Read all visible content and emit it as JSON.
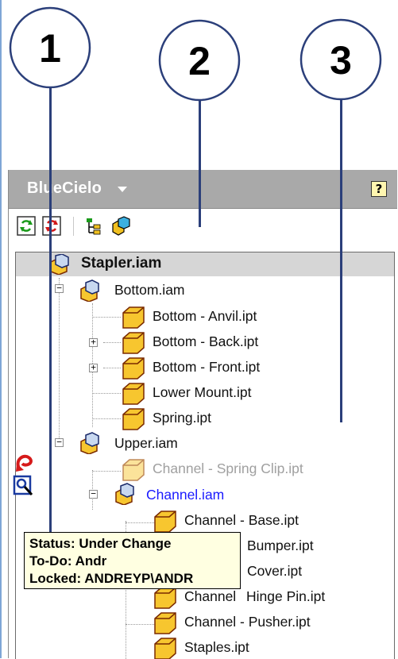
{
  "callouts": [
    "1",
    "2",
    "3"
  ],
  "panel": {
    "title": "BlueCielo",
    "help_label": "?"
  },
  "toolbar": {
    "buttons": [
      "refresh-green-icon",
      "refresh-red-icon",
      "tree-view-icon",
      "assembly-view-icon"
    ]
  },
  "tree": {
    "root": "Stapler.iam",
    "bottom": "Bottom.iam",
    "bottom_children": [
      "Bottom - Anvil.ipt",
      "Bottom - Back.ipt",
      "Bottom - Front.ipt",
      "Lower Mount.ipt",
      "Spring.ipt"
    ],
    "upper": "Upper.iam",
    "spring_clip": "Channel - Spring Clip.ipt",
    "channel": "Channel.iam",
    "channel_children": [
      "Channel - Base.ipt",
      "Bumper.ipt",
      "Cover.ipt",
      "Hinge Pin.ipt",
      "Channel - Pusher.ipt"
    ],
    "staples": "Staples.ipt",
    "hinge_prefix": "Channel"
  },
  "tooltip": {
    "status": "Status: Under Change",
    "todo": "To-Do: Andr",
    "locked": "Locked: ANDREYP\\ANDR"
  },
  "colors": {
    "callout": "#2b3f7a",
    "header": "#a9a9a9",
    "tooltip_bg": "#ffffe1",
    "gray_text": "#a0a0a0",
    "blue_text": "#1a1aff",
    "part_fill": "#f7c62f"
  }
}
